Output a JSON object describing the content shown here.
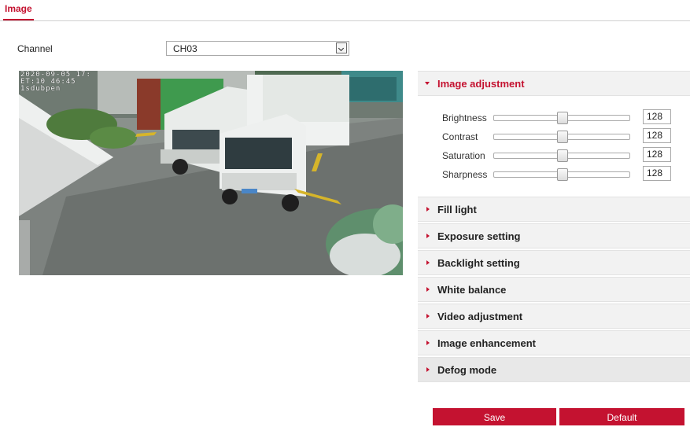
{
  "tab": {
    "label": "Image"
  },
  "channel": {
    "label": "Channel",
    "value": "CH03"
  },
  "preview": {
    "osd_lines": [
      "2020-09-05 17:",
      "ET:10 46:45",
      "1sdubpen"
    ]
  },
  "sections": {
    "image_adjustment": {
      "title": "Image adjustment"
    },
    "fill_light": {
      "title": "Fill light"
    },
    "exposure_setting": {
      "title": "Exposure setting"
    },
    "backlight_setting": {
      "title": "Backlight setting"
    },
    "white_balance": {
      "title": "White balance"
    },
    "video_adjustment": {
      "title": "Video adjustment"
    },
    "image_enhancement": {
      "title": "Image enhancement"
    },
    "defog_mode": {
      "title": "Defog mode"
    }
  },
  "sliders": [
    {
      "label": "Brightness",
      "value": "128",
      "level": 0.5
    },
    {
      "label": "Contrast",
      "value": "128",
      "level": 0.5
    },
    {
      "label": "Saturation",
      "value": "128",
      "level": 0.5
    },
    {
      "label": "Sharpness",
      "value": "128",
      "level": 0.5
    }
  ],
  "buttons": {
    "save": "Save",
    "default": "Default"
  },
  "colors": {
    "accent": "#c41230"
  },
  "icons": {
    "dropdown": "chevron-down-icon",
    "expanded": "caret-down-icon",
    "collapsed": "caret-right-icon"
  }
}
